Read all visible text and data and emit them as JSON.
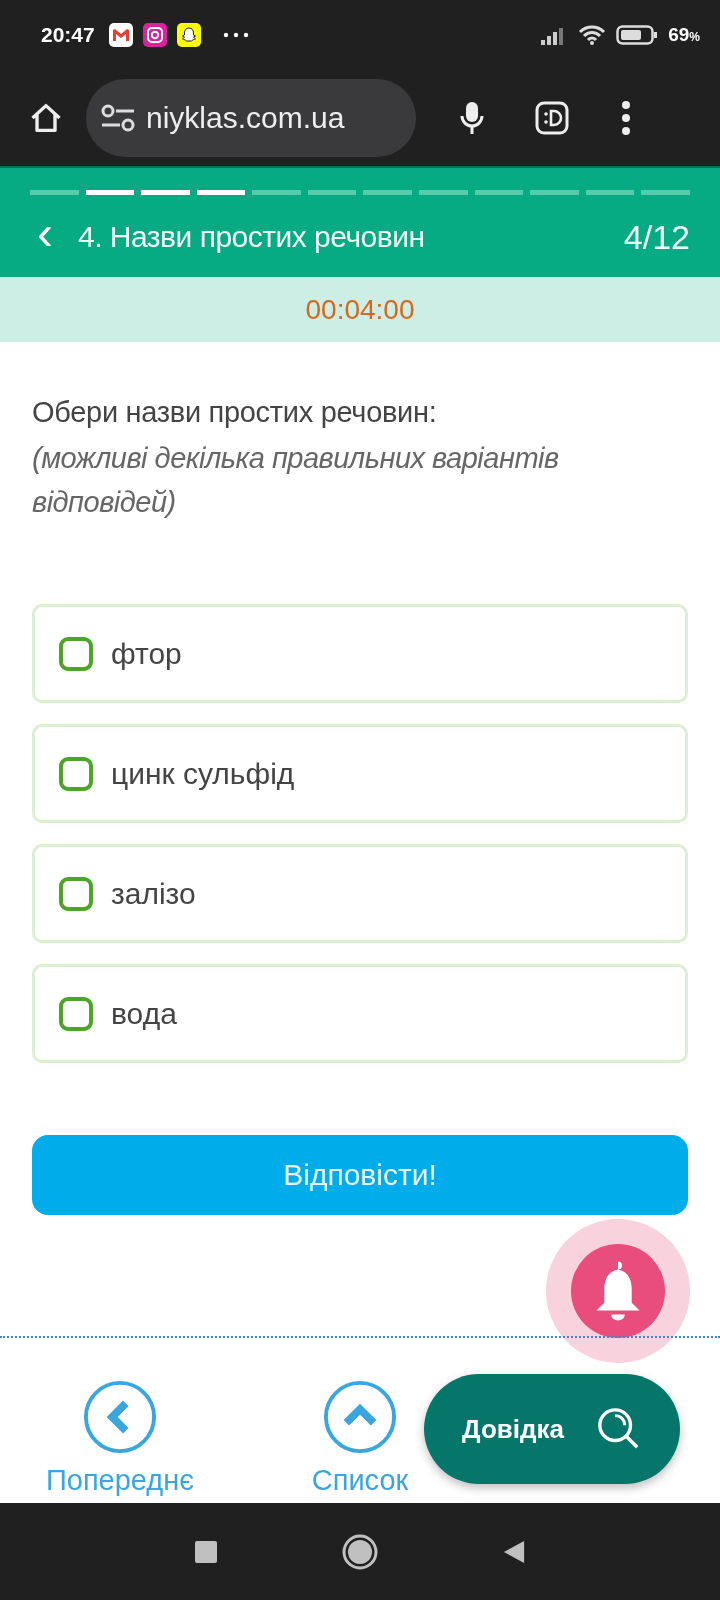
{
  "status_bar": {
    "time": "20:47",
    "battery": "69",
    "battery_unit": "%"
  },
  "browser": {
    "url": "niyklas.com.ua"
  },
  "progress": [
    {
      "selected": false
    },
    {
      "selected": true
    },
    {
      "selected": true
    },
    {
      "selected": true
    },
    {
      "selected": false
    },
    {
      "selected": false
    },
    {
      "selected": false
    },
    {
      "selected": false
    },
    {
      "selected": false
    },
    {
      "selected": false
    },
    {
      "selected": false
    },
    {
      "selected": false
    }
  ],
  "header": {
    "back": "‹",
    "title": "4. Назви простих речовин",
    "counter": "4/12"
  },
  "timer": "00:04:00",
  "question": {
    "text": "Обери назви простих речовин:",
    "hint": "(можливі декілька правильних варіантів відповідей)"
  },
  "options": [
    {
      "label": "фтор",
      "checked": false
    },
    {
      "label": "цинк сульфід",
      "checked": false
    },
    {
      "label": "залізо",
      "checked": false
    },
    {
      "label": "вода",
      "checked": false
    }
  ],
  "submit": "Відповісти!",
  "nav": [
    {
      "kind": "prev",
      "label": "Попереднє"
    },
    {
      "kind": "list",
      "label": "Список"
    }
  ],
  "help_button": "Довідка"
}
